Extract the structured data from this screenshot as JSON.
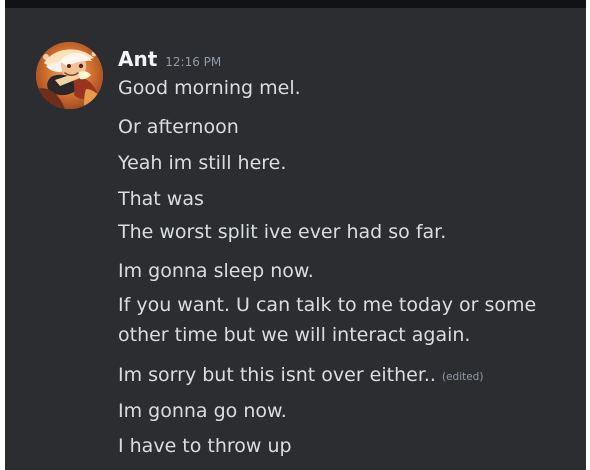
{
  "colors": {
    "panel_background": "#2b2d31",
    "username": "#f2f3f5",
    "message_text": "#dbdee1",
    "meta_text": "#949ba4"
  },
  "message": {
    "author": "Ant",
    "timestamp": "12:16 PM",
    "avatar_icon": "anime-character-avatar-icon",
    "lines": [
      "Good morning mel.",
      "Or afternoon",
      "Yeah im still here.",
      "That was",
      "The worst split ive ever had so far.",
      "Im gonna sleep now.",
      "If you want. U can talk to me today or some",
      "other time but we will interact again.",
      "Im sorry but this isnt over either..",
      "Im gonna go now.",
      "I have to throw up"
    ],
    "edited_label": "(edited)"
  }
}
